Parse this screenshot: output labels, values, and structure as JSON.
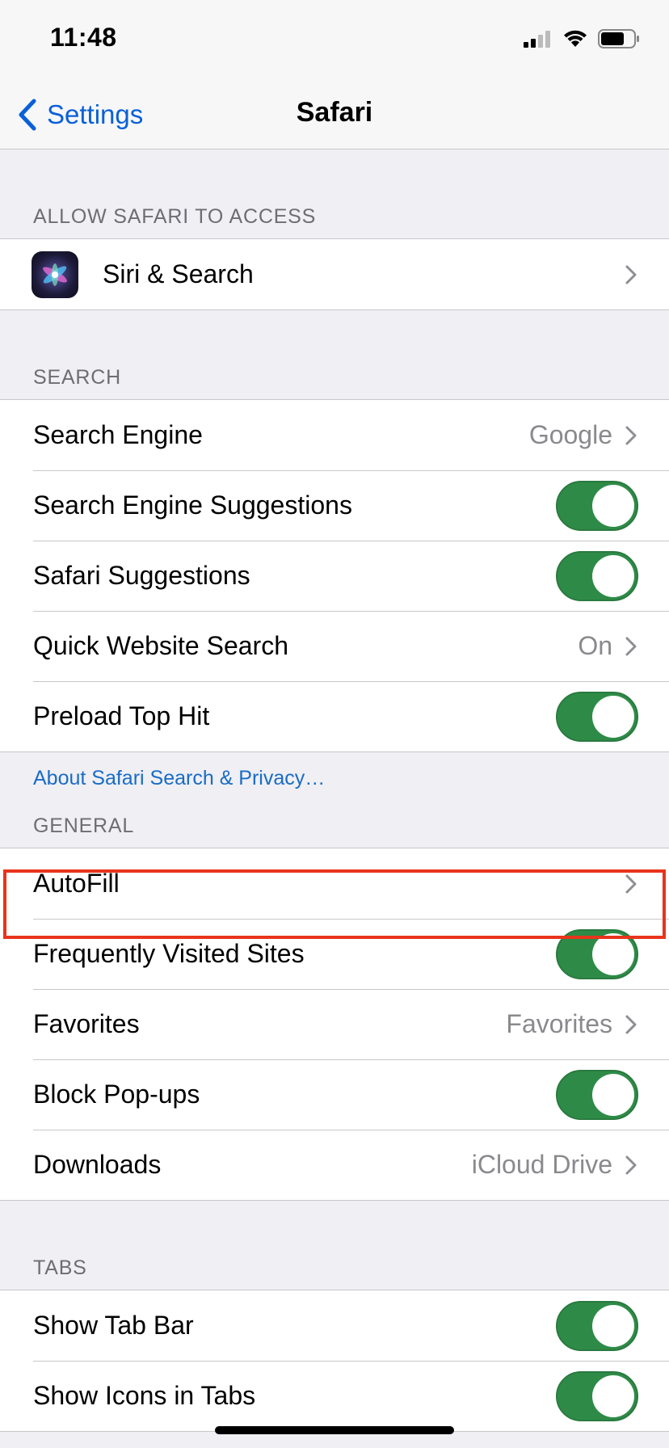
{
  "status_bar": {
    "time": "11:48"
  },
  "nav": {
    "back_label": "Settings",
    "title": "Safari"
  },
  "sections": {
    "allow_access": {
      "header": "ALLOW SAFARI TO ACCESS",
      "siri_label": "Siri & Search"
    },
    "search": {
      "header": "SEARCH",
      "search_engine": {
        "label": "Search Engine",
        "value": "Google"
      },
      "search_engine_suggestions": {
        "label": "Search Engine Suggestions",
        "on": true
      },
      "safari_suggestions": {
        "label": "Safari Suggestions",
        "on": true
      },
      "quick_website_search": {
        "label": "Quick Website Search",
        "value": "On"
      },
      "preload_top_hit": {
        "label": "Preload Top Hit",
        "on": true
      },
      "footer_link": "About Safari Search & Privacy…"
    },
    "general": {
      "header": "GENERAL",
      "autofill": {
        "label": "AutoFill"
      },
      "frequently_visited": {
        "label": "Frequently Visited Sites",
        "on": true
      },
      "favorites": {
        "label": "Favorites",
        "value": "Favorites"
      },
      "block_popups": {
        "label": "Block Pop-ups",
        "on": true
      },
      "downloads": {
        "label": "Downloads",
        "value": "iCloud Drive"
      }
    },
    "tabs": {
      "header": "TABS",
      "show_tab_bar": {
        "label": "Show Tab Bar",
        "on": true
      },
      "show_icons_in_tabs": {
        "label": "Show Icons in Tabs",
        "on": true
      }
    }
  },
  "colors": {
    "accent": "#0a60d8",
    "toggle_on": "#2e8b47",
    "highlight": "#e8341c",
    "background": "#efeff4"
  },
  "icons": {
    "siri": "siri-icon",
    "back": "chevron-left-icon",
    "disclosure": "chevron-right-icon"
  }
}
